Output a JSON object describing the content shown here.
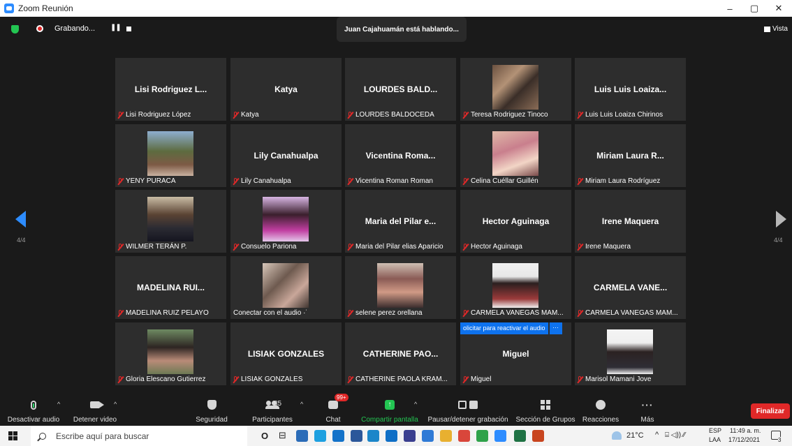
{
  "window": {
    "title": "Zoom Reunión",
    "minimize": "–",
    "maximize": "▢",
    "close": "✕"
  },
  "topbar": {
    "recording_label": "Grabando...",
    "pause_glyph": "❚❚",
    "speaker_banner": "Juan Cajahuamán está hablando...",
    "view_label": "Vista"
  },
  "pager": {
    "left_page": "4/4",
    "right_page": "4/4"
  },
  "participants": [
    {
      "big_name": "Lisi Rodriguez L...",
      "label": "Lisi Rodriguez López",
      "muted": true,
      "photo": ""
    },
    {
      "big_name": "Katya",
      "label": "Katya",
      "muted": true,
      "photo": ""
    },
    {
      "big_name": "LOURDES BALD...",
      "label": "LOURDES BALDOCEDA",
      "muted": true,
      "photo": ""
    },
    {
      "big_name": "",
      "label": "Teresa Rodriguez Tinoco",
      "muted": true,
      "photo": "p-group"
    },
    {
      "big_name": "Luis Luis Loaiza...",
      "label": "Luis Luis Loaiza  Chirinos",
      "muted": true,
      "photo": ""
    },
    {
      "big_name": "",
      "label": "YENY PURACA",
      "muted": true,
      "photo": "p-tree"
    },
    {
      "big_name": "Lily Canahualpa",
      "label": "Lily Canahualpa",
      "muted": true,
      "photo": ""
    },
    {
      "big_name": "Vicentina Roma...",
      "label": "Vicentina Roman Roman",
      "muted": true,
      "photo": ""
    },
    {
      "big_name": "",
      "label": "Celina Cuéllar Guillén",
      "muted": true,
      "photo": "p-girl"
    },
    {
      "big_name": "Miriam Laura R...",
      "label": "Miriam Laura Rodríguez",
      "muted": true,
      "photo": ""
    },
    {
      "big_name": "",
      "label": "WILMER TERÁN P.",
      "muted": true,
      "photo": "p-man"
    },
    {
      "big_name": "",
      "label": "Consuelo Pariona",
      "muted": true,
      "photo": "p-pink"
    },
    {
      "big_name": "Maria del Pilar e...",
      "label": "Maria del Pilar elias Aparicio",
      "muted": true,
      "photo": ""
    },
    {
      "big_name": "Hector Aguinaga",
      "label": "Hector Aguinaga",
      "muted": true,
      "photo": ""
    },
    {
      "big_name": "Irene Maquera",
      "label": "Irene Maquera",
      "muted": true,
      "photo": ""
    },
    {
      "big_name": "MADELINA RUI...",
      "label": "MADELINA RUIZ PELAYO",
      "muted": true,
      "photo": ""
    },
    {
      "big_name": "",
      "label": "Conectar con el audio ·˙",
      "muted": false,
      "photo": "p-family"
    },
    {
      "big_name": "",
      "label": "selene perez orellana",
      "muted": true,
      "photo": "p-selene"
    },
    {
      "big_name": "",
      "label": "CARMELA VANEGAS MAM...",
      "muted": true,
      "photo": "p-carmela"
    },
    {
      "big_name": "CARMELA VANE...",
      "label": "CARMELA VANEGAS MAM...",
      "muted": true,
      "photo": ""
    },
    {
      "big_name": "",
      "label": "Gloria Elescano Gutierrez",
      "muted": true,
      "photo": "p-gloria"
    },
    {
      "big_name": "LISIAK GONZALES",
      "label": "LISIAK GONZALES",
      "muted": true,
      "photo": ""
    },
    {
      "big_name": "CATHERINE PAO...",
      "label": "CATHERINE PAOLA KRAM...",
      "muted": true,
      "photo": ""
    },
    {
      "big_name": "Miguel",
      "label": "Miguel",
      "muted": true,
      "photo": "",
      "unmute_request": "olicitar para reactivar el audio",
      "unmute_more": "···"
    },
    {
      "big_name": "",
      "label": "Marisol Mamani Jove",
      "muted": true,
      "photo": "p-marisol"
    }
  ],
  "toolbar": {
    "mute_label": "Desactivar audio",
    "video_label": "Detener video",
    "security_label": "Seguridad",
    "participants_label": "Participantes",
    "participants_count": "85",
    "chat_label": "Chat",
    "chat_badge": "99+",
    "share_label": "Compartir pantalla",
    "share_glyph": "↑",
    "record_label": "Pausar/detener grabación",
    "breakout_label": "Sección de Grupos",
    "reactions_label": "Reacciones",
    "more_label": "Más",
    "more_glyph": "···",
    "end_label": "Finalizar",
    "caret": "^"
  },
  "taskbar": {
    "search_placeholder": "Escribe aquí para buscar",
    "cortana_glyph": "O",
    "taskview_glyph": "⊟",
    "temperature": "21°C",
    "tray_caret": "^",
    "tray_icons": "⌸ ◁)) ⁄⁄",
    "lang_top": "ESP",
    "lang_bottom": "LAA",
    "time": "11:49 a. m.",
    "date": "17/12/2021",
    "notification_count": "3",
    "apps": [
      {
        "name": "file-explorer-icon",
        "color": "#2b6cb8"
      },
      {
        "name": "skype-icon",
        "color": "#1da0e0"
      },
      {
        "name": "skype-business-icon",
        "color": "#1372c9"
      },
      {
        "name": "word-icon",
        "color": "#2b579a"
      },
      {
        "name": "edge-icon",
        "color": "#1b86c9"
      },
      {
        "name": "mail-icon",
        "color": "#0f6fc6"
      },
      {
        "name": "media-icon",
        "color": "#3a3f8f"
      },
      {
        "name": "outlook-icon",
        "color": "#2f7ad6"
      },
      {
        "name": "folder-icon",
        "color": "#e8b030"
      },
      {
        "name": "chrome-icon",
        "color": "#d9463b"
      },
      {
        "name": "chrome-alt-icon",
        "color": "#2fa24a"
      },
      {
        "name": "zoom-icon",
        "color": "#2d8cff"
      },
      {
        "name": "excel-icon",
        "color": "#1f7244"
      },
      {
        "name": "powerpoint-icon",
        "color": "#c8451f"
      }
    ]
  }
}
